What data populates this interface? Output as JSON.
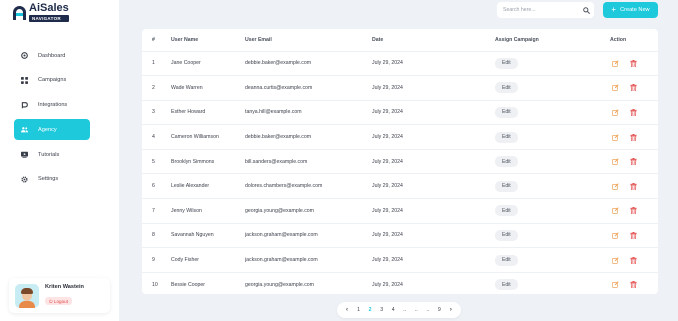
{
  "app": {
    "name": "AiSales",
    "subtitle": "NAVIGATOR"
  },
  "sidebar": {
    "items": [
      {
        "label": "Dashboard",
        "icon": "dashboard-icon"
      },
      {
        "label": "Campaigns",
        "icon": "grid-icon"
      },
      {
        "label": "Integrations",
        "icon": "plug-icon"
      },
      {
        "label": "Agency",
        "icon": "users-icon",
        "active": true
      },
      {
        "label": "Tutorials",
        "icon": "video-icon"
      },
      {
        "label": "Settings",
        "icon": "gear-icon"
      }
    ]
  },
  "user": {
    "name": "Kriten Wastein",
    "logout_label": "Logout"
  },
  "header": {
    "search_placeholder": "Search here...",
    "create_label": "Create New"
  },
  "table": {
    "headers": {
      "num": "#",
      "name": "User Name",
      "email": "User Email",
      "date": "Date",
      "assign": "Assign Campaign",
      "action": "Action"
    },
    "edit_label": "Edit",
    "rows": [
      {
        "num": "1",
        "name": "Jane Cooper",
        "email": "debbie.baker@example.com",
        "date": "July 29, 2024"
      },
      {
        "num": "2",
        "name": "Wade Warren",
        "email": "deanna.curtis@example.com",
        "date": "July 29, 2024"
      },
      {
        "num": "3",
        "name": "Esther Howard",
        "email": "tanya.hill@example.com",
        "date": "July 29, 2024"
      },
      {
        "num": "4",
        "name": "Cameron Williamson",
        "email": "debbie.baker@example.com",
        "date": "July 29, 2024"
      },
      {
        "num": "5",
        "name": "Brooklyn Simmons",
        "email": "bill.sanders@example.com",
        "date": "July 29, 2024"
      },
      {
        "num": "6",
        "name": "Leslie Alexander",
        "email": "dolores.chambers@example.com",
        "date": "July 29, 2024"
      },
      {
        "num": "7",
        "name": "Jenny Wilson",
        "email": "georgia.young@example.com",
        "date": "July 29, 2024"
      },
      {
        "num": "8",
        "name": "Savannah Nguyen",
        "email": "jackson.graham@example.com",
        "date": "July 29, 2024"
      },
      {
        "num": "9",
        "name": "Cody Fisher",
        "email": "jackson.graham@example.com",
        "date": "July 29, 2024"
      },
      {
        "num": "10",
        "name": "Bessie Cooper",
        "email": "georgia.young@example.com",
        "date": "July 29, 2024"
      }
    ]
  },
  "pagination": {
    "pages": [
      "1",
      "2",
      "3",
      "4",
      "..",
      "..",
      "..",
      "9"
    ],
    "current": "2",
    "prev": "‹",
    "next": "›"
  },
  "colors": {
    "accent": "#1ec9dc",
    "delete": "#e24a4a",
    "edit": "#f0a35a"
  }
}
